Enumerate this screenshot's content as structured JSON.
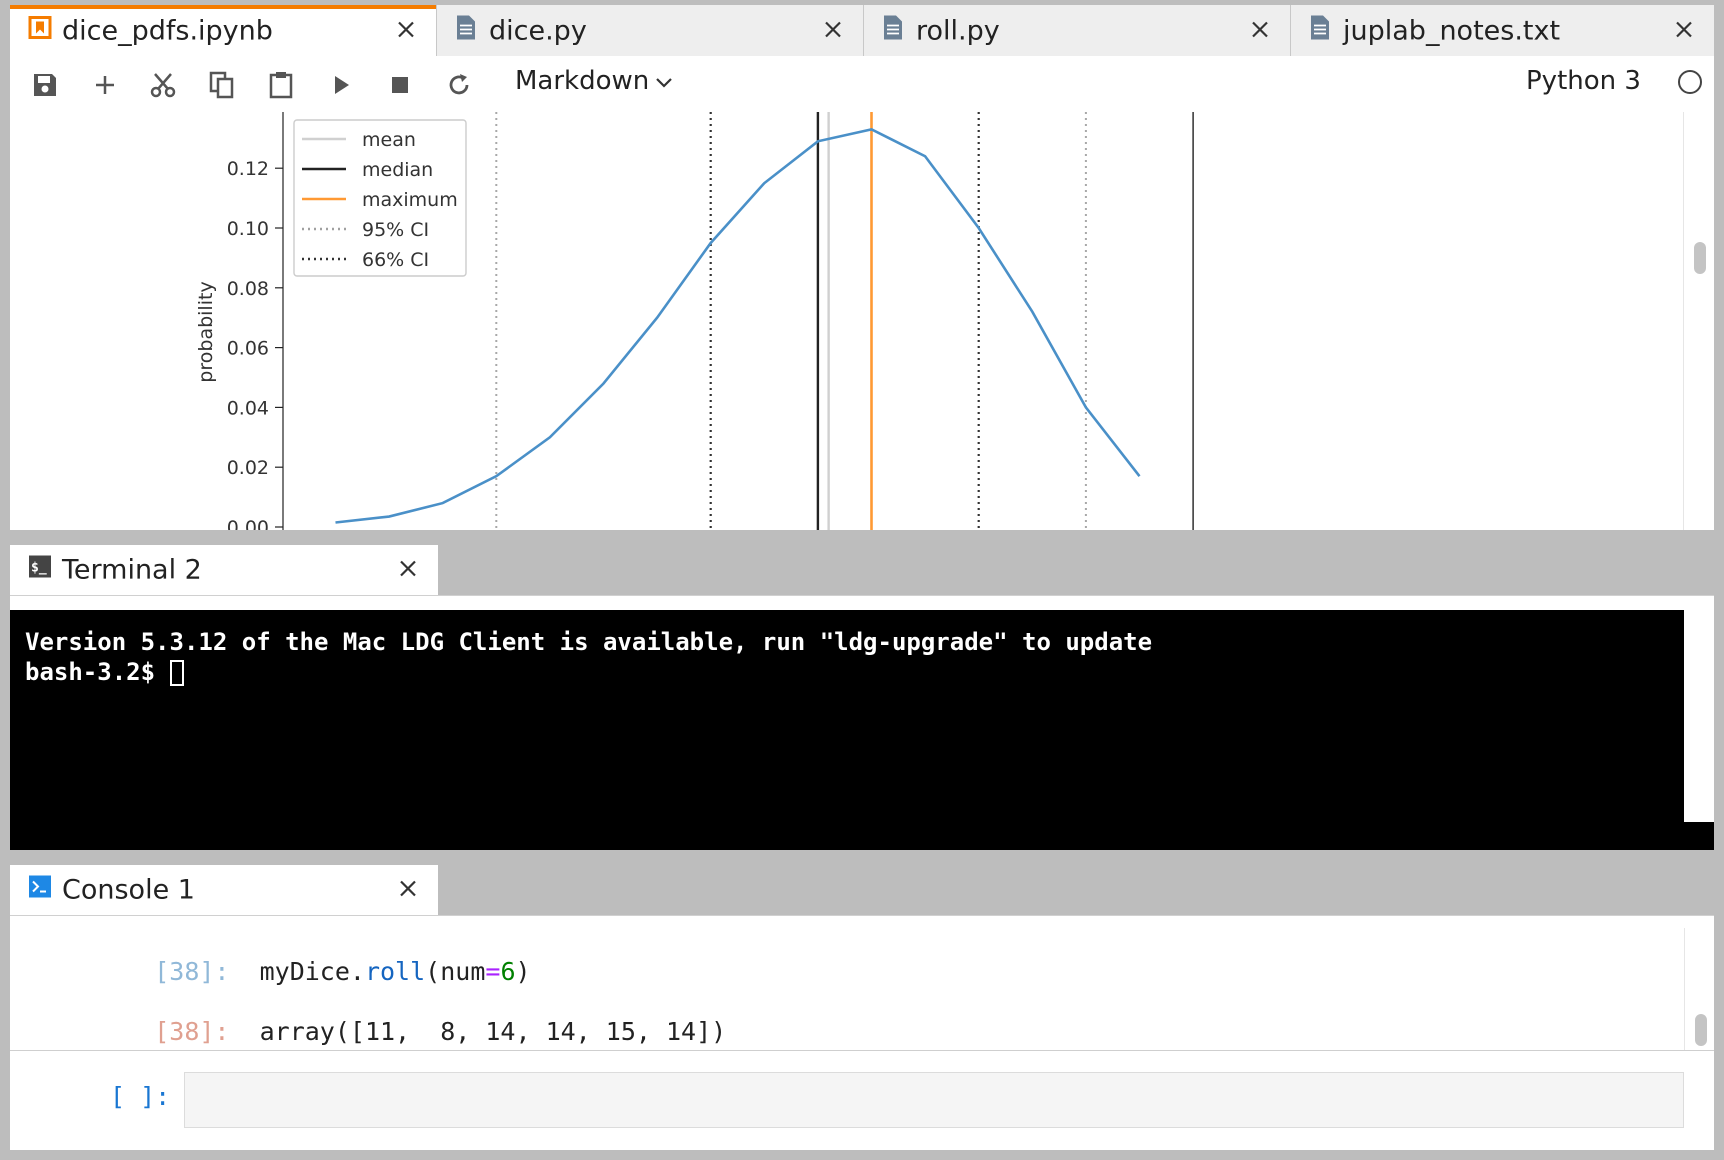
{
  "editor_tabs": [
    {
      "label": "dice_pdfs.ipynb",
      "icon": "notebook-icon",
      "active": true
    },
    {
      "label": "dice.py",
      "icon": "file-icon",
      "active": false
    },
    {
      "label": "roll.py",
      "icon": "file-icon",
      "active": false
    },
    {
      "label": "juplab_notes.txt",
      "icon": "file-icon",
      "active": false
    }
  ],
  "toolbar": {
    "buttons": [
      "save-icon",
      "add-icon",
      "cut-icon",
      "copy-icon",
      "paste-icon",
      "run-icon",
      "stop-icon",
      "restart-icon"
    ],
    "cell_type": "Markdown",
    "kernel": "Python 3"
  },
  "chart_data": {
    "type": "line",
    "ylabel": "probability",
    "yticks": [
      "0.00",
      "0.02",
      "0.04",
      "0.06",
      "0.08",
      "0.10",
      "0.12"
    ],
    "ylim": [
      0.0,
      0.135
    ],
    "x": [
      3,
      4,
      5,
      6,
      7,
      8,
      9,
      10,
      11,
      12,
      13,
      14,
      15,
      16,
      17,
      18
    ],
    "values": [
      0.0015,
      0.0035,
      0.008,
      0.017,
      0.03,
      0.048,
      0.07,
      0.095,
      0.115,
      0.129,
      0.133,
      0.124,
      0.1,
      0.072,
      0.04,
      0.017
    ],
    "legend": {
      "position": "top-left",
      "entries": [
        {
          "label": "mean",
          "color": "#d0d0d0",
          "style": "solid"
        },
        {
          "label": "median",
          "color": "#222222",
          "style": "solid"
        },
        {
          "label": "maximum",
          "color": "#ff9933",
          "style": "solid"
        },
        {
          "label": "95% CI",
          "color": "#a0a0a0",
          "style": "dotted"
        },
        {
          "label": "66% CI",
          "color": "#333333",
          "style": "dotted"
        }
      ]
    },
    "markers": {
      "mean": 12.2,
      "median": 12,
      "maximum": 13,
      "ci95": [
        6,
        17
      ],
      "ci66": [
        10,
        15
      ],
      "axis_right": 19
    },
    "line_color": "#4a90c8"
  },
  "terminal": {
    "tab_label": "Terminal 2",
    "lines": [
      "Version 5.3.12 of the Mac LDG Client is available, run \"ldg-upgrade\" to update",
      "bash-3.2$ "
    ]
  },
  "console": {
    "tab_label": "Console 1",
    "in_prompt": "[38]:",
    "in_code": {
      "obj": "myDice.",
      "fn": "roll",
      "open": "(",
      "kw": "num",
      "eq": "=",
      "num": "6",
      "close": ")"
    },
    "out_prompt": "[38]:",
    "out_text": "array([11,  8, 14, 14, 15, 14])",
    "new_prompt": "[ ]:"
  },
  "colors": {
    "accent": "#f57c00",
    "line": "#4a90c8",
    "terminal_bg": "#000000"
  }
}
